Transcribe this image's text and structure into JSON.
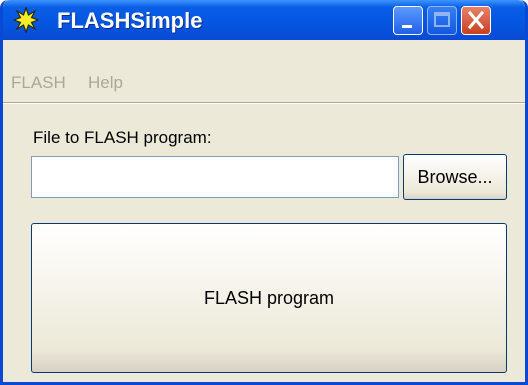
{
  "window": {
    "title": "FLASHSimple",
    "app_icon": "starburst-icon"
  },
  "title_buttons": [
    "minimize-icon",
    "maximize-icon",
    "close-icon"
  ],
  "menu": {
    "items": [
      {
        "label": "FLASH"
      },
      {
        "label": "Help"
      }
    ]
  },
  "form": {
    "file_label": "File to FLASH program:",
    "file_value": "",
    "browse_label": "Browse...",
    "program_label": "FLASH program"
  },
  "colors": {
    "titlebar": "#0a49d4",
    "window_bg": "#ece9d8",
    "close_button": "#c9401f",
    "menu_text_disabled": "#aca899"
  }
}
